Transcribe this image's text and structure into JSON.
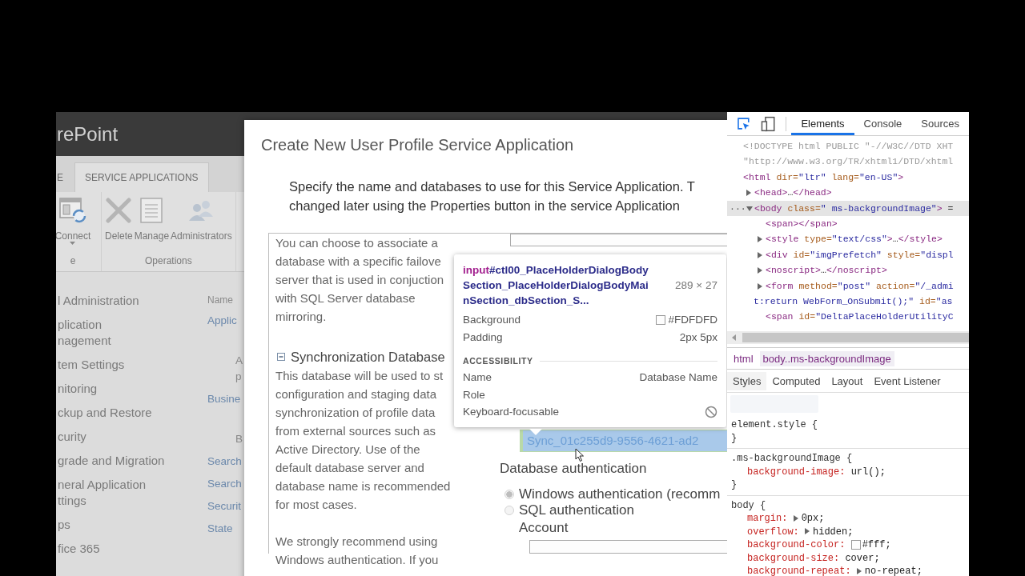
{
  "sharepoint": {
    "brand": "rePoint",
    "ribbon_tabs": [
      {
        "label": "E",
        "selected": false
      },
      {
        "label": "SERVICE APPLICATIONS",
        "selected": true
      }
    ],
    "ribbon_groups": [
      {
        "label": "e",
        "buttons": [
          {
            "label": "Connect",
            "dropdown": true
          }
        ]
      },
      {
        "label": "Operations",
        "buttons": [
          {
            "label": "Delete"
          },
          {
            "label": "Manage"
          },
          {
            "label": "Administrators"
          }
        ]
      }
    ],
    "nav": [
      {
        "lines": [
          "l Administration"
        ]
      },
      {
        "lines": [
          "plication",
          "nagement"
        ]
      },
      {
        "lines": [
          "tem Settings"
        ]
      },
      {
        "lines": [
          "nitoring"
        ]
      },
      {
        "lines": [
          "ckup and Restore"
        ]
      },
      {
        "lines": [
          "curity"
        ]
      },
      {
        "lines": [
          "grade and Migration"
        ]
      },
      {
        "lines": [
          "neral Application",
          "ttings"
        ]
      },
      {
        "lines": [
          "ps"
        ]
      },
      {
        "lines": [
          "fice 365"
        ]
      }
    ],
    "list_header": "Name",
    "list_items": [
      {
        "kind": "link",
        "lines": [
          "Applic"
        ]
      },
      {
        "kind": "desc",
        "lines": [
          "A",
          "p"
        ]
      },
      {
        "kind": "link",
        "lines": [
          "Busine"
        ]
      },
      {
        "kind": "desc",
        "lines": [
          "B"
        ]
      },
      {
        "kind": "link",
        "lines": [
          "Search"
        ]
      },
      {
        "kind": "link",
        "lines": [
          "Search"
        ]
      },
      {
        "kind": "link",
        "lines": [
          "Securit"
        ]
      },
      {
        "kind": "link",
        "lines": [
          "State"
        ]
      }
    ]
  },
  "dialog": {
    "title": "Create New User Profile Service Application",
    "intro": [
      "Specify the name and databases to use for this Service Application. T",
      "changed later using the Properties button in the service Application"
    ],
    "failover_note": [
      "You can choose to associate a",
      "database with a specific failove",
      "server that is used in conjuction",
      "with SQL Server database",
      "mirroring."
    ],
    "sync_section": {
      "title": "Synchronization Database",
      "expanded": true,
      "description": [
        "This database will be used to st",
        "configuration and staging data",
        "synchronization of profile data",
        "from external sources such as",
        "Active Directory. Use of the",
        "default database server and",
        "database name is recommended",
        "for most cases."
      ],
      "recommendation": [
        "We strongly recommend using",
        "Windows authentication. If you"
      ]
    },
    "sync_database_name": {
      "value": "Sync_01c255d9-9556-4621-ad2",
      "highlighted": true
    },
    "auth": {
      "label": "Database authentication",
      "options": [
        {
          "label": "Windows authentication (recomm",
          "selected": true
        },
        {
          "label": "SQL authentication",
          "selected": false
        }
      ],
      "account_label": "Account"
    }
  },
  "inspect_tooltip": {
    "selector": {
      "tag": "input",
      "lines": [
        "#ctl00_PlaceHolderDialogBody",
        "Section_PlaceHolderDialogBodyMai",
        "nSection_dbSection_S..."
      ]
    },
    "size": "289 × 27",
    "properties": [
      {
        "name": "Background",
        "value": "#FDFDFD",
        "swatch": true
      },
      {
        "name": "Padding",
        "value": "2px 5px"
      }
    ],
    "section": "ACCESSIBILITY",
    "accessibility": [
      {
        "name": "Name",
        "value": "Database Name"
      },
      {
        "name": "Role"
      },
      {
        "name": "Keyboard-focusable",
        "focusable": false
      }
    ]
  },
  "devtools": {
    "tabs": [
      {
        "label": "Elements",
        "selected": true
      },
      {
        "label": "Console",
        "selected": false
      },
      {
        "label": "Sources",
        "selected": false
      }
    ],
    "dom": [
      {
        "selected": false,
        "tokens": [
          {
            "doc": "<!DOCTYPE html PUBLIC \"-//W3C//DTD XHT"
          }
        ]
      },
      {
        "selected": false,
        "tokens": [
          {
            "doc": "\"http://www.w3.org/TR/xhtml1/DTD/xhtml"
          }
        ]
      },
      {
        "selected": false,
        "tokens": [
          {
            "tag": "<html"
          },
          {
            "attr": " dir="
          },
          {
            "val": "\"ltr\""
          },
          {
            "attr": " lang="
          },
          {
            "val": "\"en-US\""
          },
          {
            "tag": ">"
          }
        ],
        "children": [
          {
            "selected": false,
            "expanded": false,
            "tokens": [
              {
                "tag": "<head>"
              },
              {
                "text": "…"
              },
              {
                "tag": "</head>"
              }
            ]
          },
          {
            "selected": true,
            "expanded": true,
            "gutter": "···",
            "tokens": [
              {
                "tag": "<body"
              },
              {
                "attr": " class="
              },
              {
                "val": "\" ms-backgroundImage\""
              },
              {
                "tag": ">"
              },
              {
                "text": " ="
              }
            ],
            "children": [
              {
                "selected": false,
                "tokens": [
                  {
                    "tag": "<span></span>"
                  }
                ]
              },
              {
                "selected": false,
                "expanded": false,
                "tokens": [
                  {
                    "tag": "<style"
                  },
                  {
                    "attr": " type="
                  },
                  {
                    "val": "\"text/css\""
                  },
                  {
                    "tag": ">"
                  },
                  {
                    "text": "…"
                  },
                  {
                    "tag": "</style>"
                  }
                ]
              },
              {
                "selected": false,
                "expanded": false,
                "tokens": [
                  {
                    "tag": "<div"
                  },
                  {
                    "attr": " id="
                  },
                  {
                    "val": "\"imgPrefetch\""
                  },
                  {
                    "attr": " style="
                  },
                  {
                    "val": "\"displ"
                  }
                ]
              },
              {
                "selected": false,
                "expanded": false,
                "tokens": [
                  {
                    "tag": "<noscript>"
                  },
                  {
                    "text": "…"
                  },
                  {
                    "tag": "</noscript>"
                  }
                ]
              },
              {
                "selected": false,
                "expanded": false,
                "tokens": [
                  {
                    "tag": "<form"
                  },
                  {
                    "attr": " method="
                  },
                  {
                    "val": "\"post\""
                  },
                  {
                    "attr": " action="
                  },
                  {
                    "val": "\"/_admi"
                  }
                ],
                "wrap": [
                  {
                    "val": "t:return WebForm_OnSubmit();\""
                  },
                  {
                    "attr": " id="
                  },
                  {
                    "val": "\"as"
                  }
                ]
              },
              {
                "selected": false,
                "tokens": [
                  {
                    "tag": "<span"
                  },
                  {
                    "attr": " id="
                  },
                  {
                    "val": "\"DeltaPlaceHolderUtilityC"
                  }
                ]
              }
            ]
          }
        ]
      }
    ],
    "breadcrumb": [
      {
        "label": "html",
        "selected": false
      },
      {
        "label": "body..ms-backgroundImage",
        "selected": true
      }
    ],
    "style_tabs": [
      {
        "label": "Styles",
        "selected": true
      },
      {
        "label": "Computed",
        "selected": false
      },
      {
        "label": "Layout",
        "selected": false
      },
      {
        "label": "Event Listener",
        "selected": false
      }
    ],
    "rules": [
      {
        "selector": "element.style {",
        "close": "}"
      },
      {
        "selector": ".ms-backgroundImage {",
        "declarations": [
          {
            "property": "background-image:",
            "value": "url();"
          }
        ],
        "close": "}"
      },
      {
        "selector": "body {",
        "declarations": [
          {
            "property": "margin:",
            "value": "0px;",
            "expandable": true
          },
          {
            "property": "overflow:",
            "value": "hidden;",
            "expandable": true
          },
          {
            "property": "background-color:",
            "value": "#fff;",
            "swatch": true
          },
          {
            "property": "background-size:",
            "value": "cover;"
          },
          {
            "property": "background-repeat:",
            "value": "no-repeat;",
            "expandable": true
          }
        ]
      }
    ]
  }
}
